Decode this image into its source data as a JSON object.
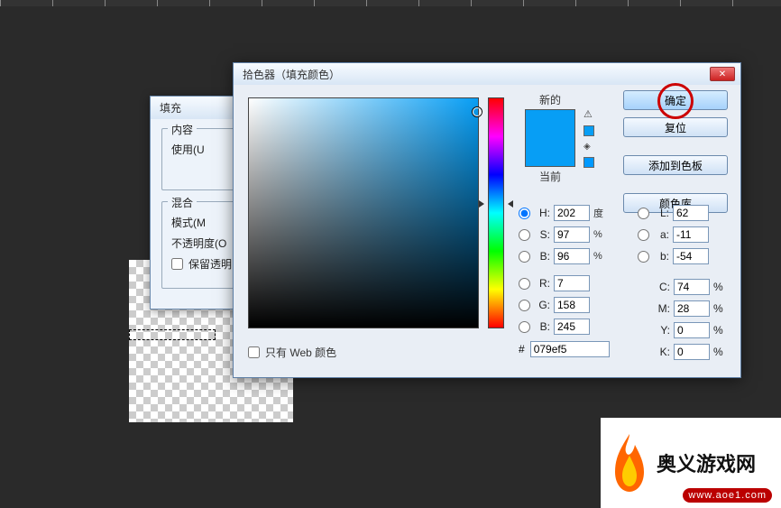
{
  "fill_dialog": {
    "title": "填充",
    "content_legend": "内容",
    "use_label": "使用(U",
    "blend_legend": "混合",
    "mode_label": "模式(M",
    "opacity_label": "不透明度(O",
    "preserve_trans": "保留透明区"
  },
  "picker": {
    "title": "拾色器（填充颜色）",
    "new_label": "新的",
    "current_label": "当前",
    "ok": "确定",
    "reset": "复位",
    "add_swatch": "添加到色板",
    "color_lib": "颜色库",
    "web_only": "只有 Web 颜色",
    "hex_prefix": "#",
    "hex": "079ef5",
    "swatch_new_color": "#079ef5",
    "swatch_cur_color": "#079ef5",
    "H": {
      "label": "H:",
      "val": "202",
      "unit": "度"
    },
    "S": {
      "label": "S:",
      "val": "97",
      "unit": "%"
    },
    "Bv": {
      "label": "B:",
      "val": "96",
      "unit": "%"
    },
    "R": {
      "label": "R:",
      "val": "7"
    },
    "G": {
      "label": "G:",
      "val": "158"
    },
    "Bc": {
      "label": "B:",
      "val": "245"
    },
    "L": {
      "label": "L:",
      "val": "62"
    },
    "a": {
      "label": "a:",
      "val": "-11"
    },
    "b": {
      "label": "b:",
      "val": "-54"
    },
    "C": {
      "label": "C:",
      "val": "74",
      "unit": "%"
    },
    "M": {
      "label": "M:",
      "val": "28",
      "unit": "%"
    },
    "Y": {
      "label": "Y:",
      "val": "0",
      "unit": "%"
    },
    "K": {
      "label": "K:",
      "val": "0",
      "unit": "%"
    }
  },
  "brand": {
    "name": "奥义游戏网",
    "url": "www.aoe1.com"
  }
}
